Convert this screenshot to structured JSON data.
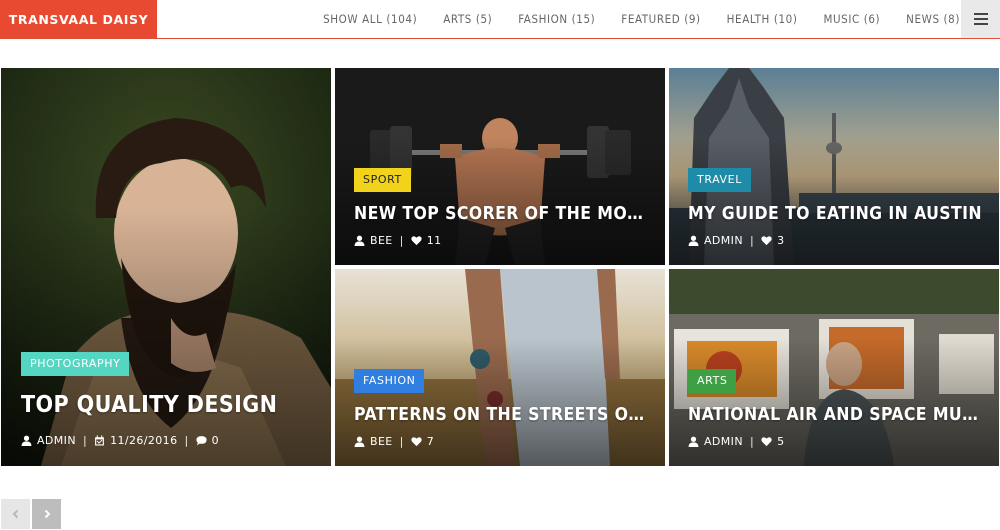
{
  "header": {
    "brand": "TRANSVAAL DAISY",
    "brand_color": "#e84a31",
    "nav": [
      {
        "label": "SHOW ALL (104)"
      },
      {
        "label": "ARTS (5)"
      },
      {
        "label": "FASHION (15)"
      },
      {
        "label": "FEATURED (9)"
      },
      {
        "label": "HEALTH (10)"
      },
      {
        "label": "MUSIC (6)"
      },
      {
        "label": "NEWS (8)"
      }
    ],
    "menu_icon": "hamburger-icon"
  },
  "posts": [
    {
      "category": "PHOTOGRAPHY",
      "category_color": "#55d6c3",
      "title": "TOP QUALITY DESIGN",
      "author": "ADMIN",
      "date": "11/26/2016",
      "comments": "0"
    },
    {
      "category": "SPORT",
      "category_color": "#f2d31b",
      "title": "NEW TOP SCORER OF THE MONTH",
      "author": "BEE",
      "likes": "11"
    },
    {
      "category": "TRAVEL",
      "category_color": "#1e8ca8",
      "title": "MY GUIDE TO EATING IN AUSTIN",
      "author": "ADMIN",
      "likes": "3"
    },
    {
      "category": "FASHION",
      "category_color": "#2f7ee0",
      "title": "PATTERNS ON THE STREETS OF ...",
      "author": "BEE",
      "likes": "7"
    },
    {
      "category": "ARTS",
      "category_color": "#3ea043",
      "title": "NATIONAL AIR AND SPACE MUSE...",
      "author": "ADMIN",
      "likes": "5"
    }
  ],
  "pager": {
    "prev_icon": "chevron-left-icon",
    "next_icon": "chevron-right-icon"
  }
}
